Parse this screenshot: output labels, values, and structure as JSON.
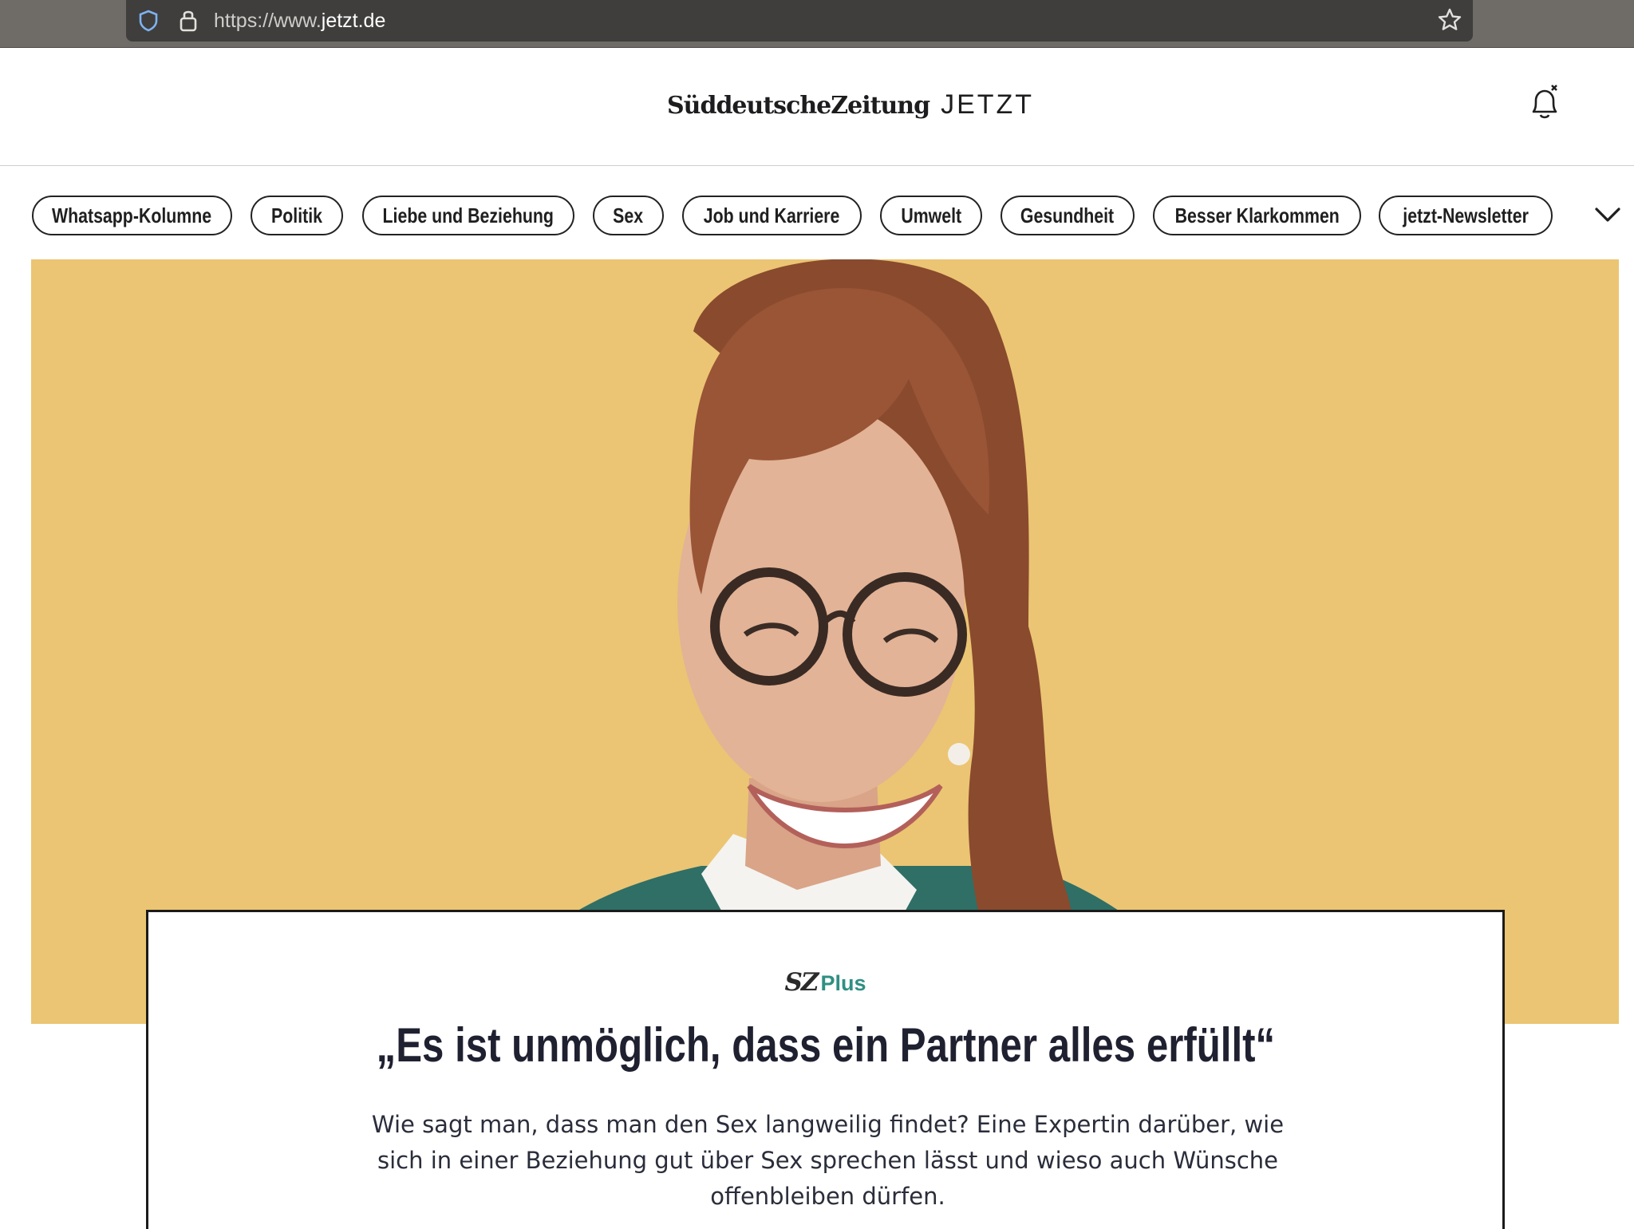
{
  "browser": {
    "url_prefix": "https://www.",
    "url_domain": "jetzt.de"
  },
  "header": {
    "logo_sz": "SüddeutscheZeitung",
    "logo_jetzt": "JETZT"
  },
  "nav": {
    "categories": [
      "Whatsapp-Kolumne",
      "Politik",
      "Liebe und Beziehung",
      "Sex",
      "Job und Karriere",
      "Umwelt",
      "Gesundheit",
      "Besser Klarkommen",
      "jetzt-Newsletter"
    ]
  },
  "article": {
    "badge_sz": "SZ",
    "badge_plus": "Plus",
    "headline": "„Es ist unmöglich, dass ein Partner alles erfüllt“",
    "teaser": "Wie sagt man, dass man den Sex langweilig findet? Eine Expertin darüber, wie sich in einer Beziehung gut über Sex sprechen lässt und wieso auch Wünsche offenbleiben dürfen."
  },
  "colors": {
    "hero_background": "#ebc573",
    "plus_accent": "#2f8f83",
    "headline": "#1f2131"
  }
}
